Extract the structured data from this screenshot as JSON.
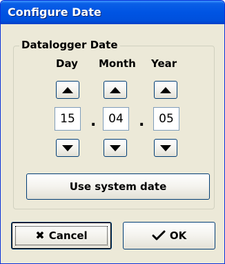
{
  "window": {
    "title": "Configure Date"
  },
  "group": {
    "legend": "Datalogger Date"
  },
  "columns": [
    {
      "label": "Day",
      "value": "15"
    },
    {
      "label": "Month",
      "value": "04"
    },
    {
      "label": "Year",
      "value": "05"
    }
  ],
  "separators": [
    ".",
    "."
  ],
  "buttons": {
    "use_system_date": "Use system date",
    "cancel": "Cancel",
    "ok": "OK"
  },
  "icons": {
    "up": "triangle-up",
    "down": "triangle-down",
    "cancel": "x-mark",
    "ok": "check-mark"
  }
}
